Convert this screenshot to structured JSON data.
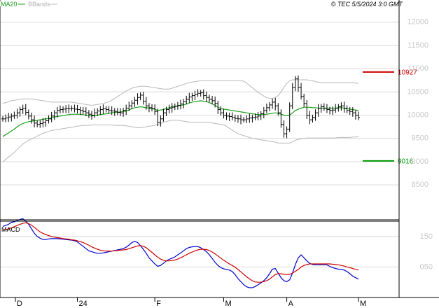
{
  "header": {
    "legend_ma": "MA20",
    "legend_bb": "BBands",
    "copyright": "© TEC 5/5/2024 3:0 GMT"
  },
  "colors": {
    "ma": "#18a018",
    "bands": "#b8b8b8",
    "price": "#000000",
    "macd": "#0000cc",
    "signal": "#cc0000",
    "resistance": "#cc0000",
    "support": "#009900",
    "grid": "#d8d8d8",
    "background": "#ffffff"
  },
  "chart_data": [
    {
      "type": "ohlc",
      "title": "",
      "y_ticks": [
        {
          "value": 12000,
          "label": "12000"
        },
        {
          "value": 11500,
          "label": "11500"
        },
        {
          "value": 11000,
          "label": "11000"
        },
        {
          "value": 10500,
          "label": "10500"
        },
        {
          "value": 10000,
          "label": "10000"
        },
        {
          "value": 9500,
          "label": "9500"
        },
        {
          "value": 9000,
          "label": "9000"
        },
        {
          "value": 8500,
          "label": "8500"
        }
      ],
      "ylim": [
        7750,
        12250
      ],
      "x_labels": [
        {
          "index": 0,
          "label": "D"
        },
        {
          "index": 26,
          "label": "24"
        },
        {
          "index": 53,
          "label": "F"
        },
        {
          "index": 77,
          "label": "M"
        },
        {
          "index": 99,
          "label": "A"
        },
        {
          "index": 124,
          "label": "M"
        }
      ],
      "n_bars": 125,
      "levels": [
        {
          "name": "resistance",
          "value": 10927,
          "label": "10927"
        },
        {
          "name": "support",
          "value": 9016,
          "label": "9016"
        }
      ],
      "grid": true,
      "legend": "top-left",
      "series": [
        {
          "name": "price",
          "close": [
            9920,
            9940,
            9960,
            9980,
            10000,
            10050,
            10120,
            10150,
            10060,
            9980,
            9900,
            9830,
            9800,
            9820,
            9850,
            9880,
            9920,
            9980,
            10050,
            10100,
            10120,
            10130,
            10140,
            10140,
            10150,
            10130,
            10120,
            10100,
            10080,
            10050,
            10020,
            10000,
            10050,
            10090,
            10120,
            10140,
            10120,
            10100,
            10090,
            10080,
            10060,
            10050,
            10100,
            10150,
            10200,
            10260,
            10320,
            10380,
            10430,
            10300,
            10200,
            10160,
            10140,
            10080,
            9850,
            9920,
            10050,
            10120,
            10150,
            10170,
            10190,
            10210,
            10240,
            10290,
            10340,
            10390,
            10420,
            10450,
            10470,
            10480,
            10420,
            10380,
            10340,
            10310,
            10250,
            10120,
            10050,
            10000,
            9980,
            9970,
            9950,
            9930,
            9920,
            9900,
            9900,
            9920,
            9940,
            9950,
            9960,
            9980,
            10030,
            10100,
            10160,
            10220,
            10280,
            10200,
            10050,
            9800,
            9600,
            9700,
            10200,
            10600,
            10780,
            10600,
            10400,
            10250,
            10000,
            9900,
            9950,
            10050,
            10150,
            10180,
            10150,
            10120,
            10100,
            10110,
            10150,
            10180,
            10200,
            10150,
            10100,
            10080,
            10050,
            10000,
            9950
          ],
          "ma20": [
            9540,
            9580,
            9620,
            9660,
            9700,
            9750,
            9790,
            9820,
            9840,
            9860,
            9870,
            9880,
            9890,
            9900,
            9910,
            9920,
            9930,
            9940,
            9960,
            9970,
            9980,
            9990,
            10000,
            10010,
            10020,
            10020,
            10020,
            10020,
            10010,
            10000,
            9990,
            9980,
            9990,
            10000,
            10010,
            10020,
            10030,
            10040,
            10050,
            10060,
            10060,
            10070,
            10080,
            10090,
            10110,
            10140,
            10160,
            10170,
            10180,
            10170,
            10160,
            10150,
            10140,
            10130,
            10100,
            10110,
            10120,
            10140,
            10160,
            10180,
            10190,
            10200,
            10210,
            10220,
            10240,
            10260,
            10280,
            10290,
            10300,
            10310,
            10300,
            10290,
            10270,
            10240,
            10210,
            10170,
            10140,
            10130,
            10120,
            10110,
            10100,
            10090,
            10080,
            10070,
            10060,
            10050,
            10040,
            10030,
            10020,
            10010,
            10010,
            10010,
            10020,
            10030,
            10040,
            10050,
            10040,
            10020,
            10000,
            9990,
            10000,
            10050,
            10100,
            10130,
            10150,
            10170,
            10170,
            10170,
            10160,
            10160,
            10150,
            10150,
            10150,
            10150,
            10150,
            10150,
            10150,
            10160,
            10160,
            10150,
            10140,
            10130,
            10120,
            10110,
            10100
          ],
          "upper": [
            10250,
            10270,
            10290,
            10310,
            10320,
            10330,
            10340,
            10350,
            10350,
            10350,
            10350,
            10340,
            10330,
            10320,
            10310,
            10300,
            10290,
            10280,
            10280,
            10280,
            10280,
            10280,
            10280,
            10280,
            10280,
            10270,
            10260,
            10250,
            10240,
            10230,
            10220,
            10210,
            10220,
            10230,
            10240,
            10250,
            10270,
            10290,
            10320,
            10360,
            10400,
            10440,
            10480,
            10520,
            10550,
            10580,
            10600,
            10610,
            10620,
            10620,
            10620,
            10610,
            10600,
            10590,
            10580,
            10570,
            10560,
            10560,
            10560,
            10580,
            10600,
            10620,
            10640,
            10660,
            10680,
            10700,
            10710,
            10720,
            10730,
            10740,
            10740,
            10740,
            10740,
            10740,
            10740,
            10740,
            10740,
            10740,
            10740,
            10740,
            10740,
            10740,
            10740,
            10740,
            10730,
            10690,
            10640,
            10590,
            10540,
            10490,
            10450,
            10410,
            10380,
            10360,
            10360,
            10380,
            10420,
            10500,
            10600,
            10680,
            10740,
            10760,
            10760,
            10760,
            10760,
            10760,
            10760,
            10750,
            10740,
            10720,
            10710,
            10700,
            10700,
            10700,
            10700,
            10700,
            10700,
            10700,
            10700,
            10700,
            10700,
            10700,
            10700,
            10690,
            10680
          ],
          "lower": [
            8990,
            9050,
            9100,
            9150,
            9200,
            9260,
            9320,
            9380,
            9420,
            9460,
            9490,
            9520,
            9550,
            9580,
            9610,
            9630,
            9650,
            9670,
            9680,
            9690,
            9700,
            9710,
            9720,
            9730,
            9740,
            9750,
            9760,
            9770,
            9780,
            9780,
            9780,
            9790,
            9790,
            9790,
            9790,
            9790,
            9790,
            9790,
            9790,
            9780,
            9780,
            9780,
            9780,
            9770,
            9760,
            9750,
            9740,
            9730,
            9730,
            9740,
            9750,
            9760,
            9770,
            9780,
            9800,
            9820,
            9840,
            9860,
            9880,
            9890,
            9890,
            9890,
            9880,
            9870,
            9860,
            9850,
            9850,
            9850,
            9850,
            9850,
            9850,
            9850,
            9840,
            9830,
            9820,
            9810,
            9800,
            9790,
            9760,
            9720,
            9680,
            9640,
            9600,
            9580,
            9560,
            9540,
            9520,
            9500,
            9490,
            9480,
            9470,
            9460,
            9450,
            9440,
            9430,
            9420,
            9400,
            9400,
            9400,
            9400,
            9400,
            9430,
            9460,
            9480,
            9490,
            9500,
            9510,
            9510,
            9510,
            9510,
            9510,
            9510,
            9510,
            9510,
            9510,
            9510,
            9510,
            9520,
            9520,
            9520,
            9520,
            9520,
            9530,
            9530,
            9540
          ]
        }
      ]
    },
    {
      "type": "line",
      "title": "MACD",
      "y_ticks": [
        {
          "value": 150,
          "label": "150"
        },
        {
          "value": 50,
          "label": "050"
        }
      ],
      "ylim": [
        -50,
        200
      ],
      "grid": true,
      "series": [
        {
          "name": "macd",
          "values": [
            183,
            186,
            190,
            196,
            198,
            202,
            206,
            208,
            200,
            190,
            175,
            160,
            150,
            144,
            140,
            140,
            142,
            143,
            143,
            143,
            142,
            141,
            140,
            139,
            138,
            136,
            132,
            125,
            118,
            110,
            103,
            100,
            97,
            95,
            95,
            96,
            98,
            100,
            102,
            104,
            106,
            108,
            110,
            115,
            122,
            130,
            134,
            130,
            120,
            108,
            95,
            80,
            70,
            60,
            52,
            55,
            62,
            70,
            75,
            79,
            83,
            90,
            96,
            103,
            110,
            114,
            116,
            117,
            117,
            113,
            107,
            100,
            90,
            78,
            65,
            55,
            48,
            44,
            42,
            40,
            35,
            25,
            12,
            2,
            -8,
            -15,
            -18,
            -18,
            -14,
            -8,
            -2,
            5,
            15,
            28,
            43,
            45,
            30,
            15,
            5,
            2,
            8,
            30,
            58,
            80,
            90,
            80,
            70,
            62,
            58,
            57,
            57,
            57,
            57,
            57,
            52,
            48,
            45,
            43,
            42,
            40,
            35,
            28,
            20,
            15,
            10
          ]
        },
        {
          "name": "signal",
          "values": [
            170,
            172,
            175,
            178,
            182,
            186,
            190,
            193,
            195,
            192,
            187,
            180,
            172,
            165,
            160,
            156,
            153,
            150,
            148,
            146,
            145,
            143,
            142,
            141,
            139,
            138,
            136,
            133,
            130,
            126,
            121,
            116,
            112,
            108,
            105,
            103,
            102,
            102,
            102,
            103,
            104,
            105,
            106,
            107,
            110,
            113,
            116,
            119,
            120,
            118,
            113,
            106,
            98,
            90,
            82,
            76,
            72,
            70,
            70,
            71,
            73,
            76,
            80,
            85,
            90,
            95,
            99,
            103,
            106,
            108,
            108,
            107,
            104,
            99,
            93,
            86,
            79,
            72,
            66,
            60,
            55,
            49,
            42,
            34,
            26,
            18,
            11,
            5,
            1,
            0,
            0,
            2,
            5,
            10,
            18,
            25,
            28,
            28,
            26,
            25,
            26,
            30,
            36,
            42,
            50,
            55,
            58,
            60,
            60,
            60,
            60,
            60,
            60,
            60,
            60,
            59,
            58,
            57,
            55,
            53,
            50,
            48,
            45,
            42,
            40
          ]
        }
      ]
    }
  ]
}
